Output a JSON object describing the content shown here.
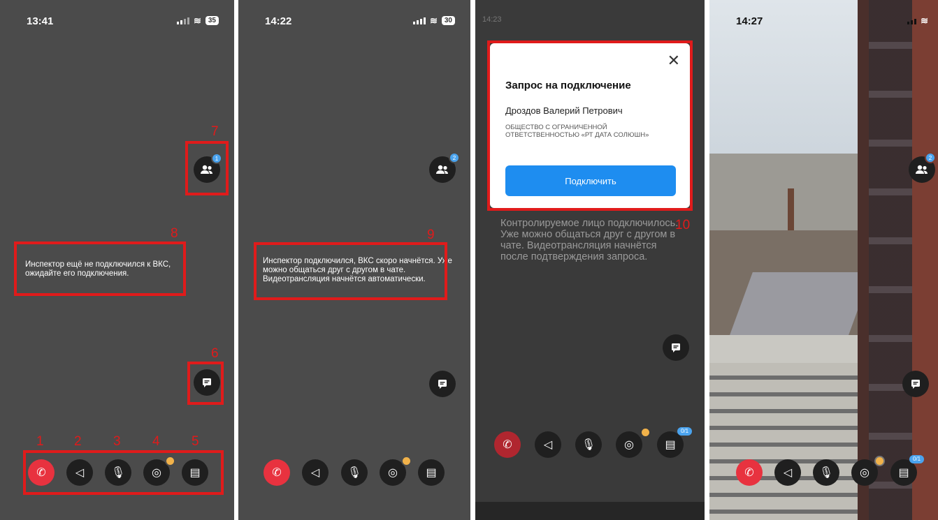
{
  "panel1": {
    "time": "13:41",
    "battery": "35",
    "participants_badge": "1",
    "message": "Инспектор ещё не подключился к ВКС, ожидайте его подключения.",
    "annotation_numbers": [
      "1",
      "2",
      "3",
      "4",
      "5",
      "6",
      "7",
      "8"
    ]
  },
  "panel2": {
    "time": "14:22",
    "battery": "30",
    "participants_badge": "2",
    "message": "Инспектор подключился, ВКС скоро начнётся. Уже можно общаться друг с другом в чате. Видеотрансляция начнётся автоматически.",
    "annotation_number": "9"
  },
  "panel3": {
    "status_time": "14:23",
    "dialog": {
      "title": "Запрос на подключение",
      "name": "Дроздов Валерий Петрович",
      "organization": "ОБЩЕСТВО С ОГРАНИЧЕННОЙ ОТВЕТСТВЕННОСТЬЮ «РТ ДАТА СОЛЮШН»",
      "connect_button": "Подключить"
    },
    "background_text": "Контролируемое лицо подключилось. Уже можно общаться друг с другом в чате. Видеотрансляция начнётся после подтверждения запроса.",
    "docs_badge": "0/1",
    "annotation_number": "10"
  },
  "panel4": {
    "time": "14:27",
    "participants_badge": "2",
    "docs_badge": "0/1"
  },
  "icons": {
    "end_call": "phone-hangup-icon",
    "speaker": "speaker-icon",
    "mic": "microphone-icon",
    "location": "location-pin-icon",
    "docs": "document-icon",
    "chat": "chat-icon",
    "participants": "participants-icon"
  },
  "colors": {
    "end_call": "#e8323f",
    "accent": "#1e8df0",
    "badge": "#4aa3ee",
    "location_dot": "#f1b24a",
    "annotation": "#e01b1b"
  }
}
